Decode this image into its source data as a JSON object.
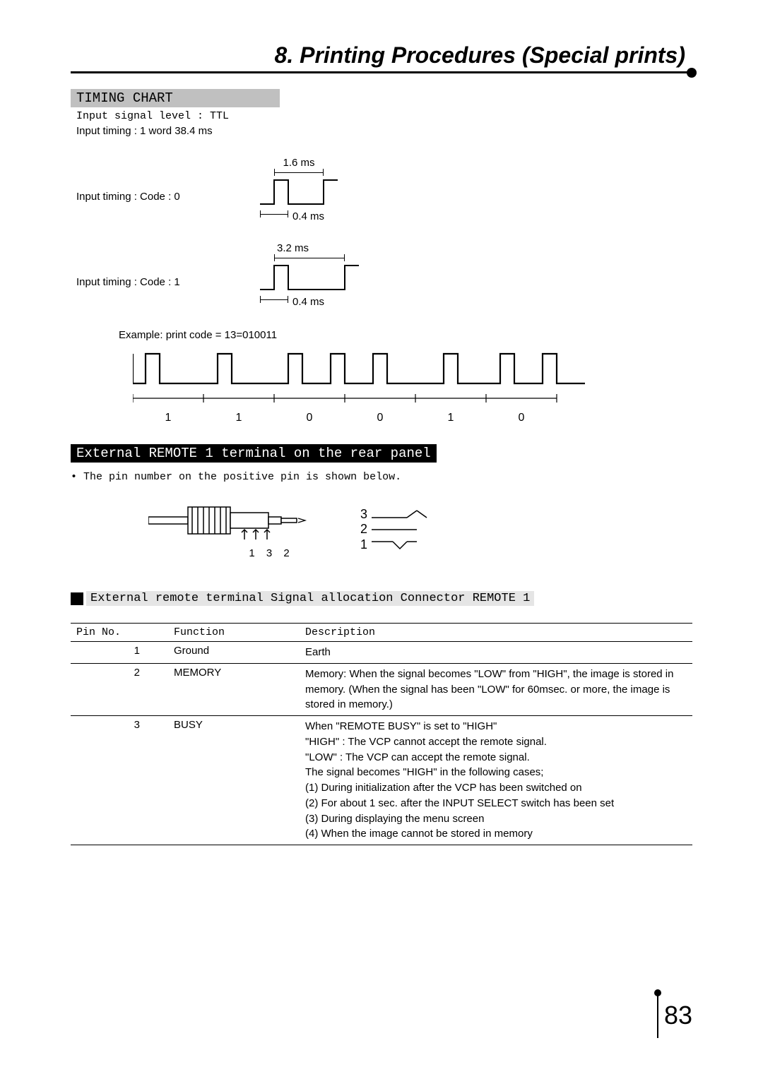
{
  "chapter_title": "8. Printing Procedures (Special prints)",
  "timing_chart": {
    "heading": "TIMING CHART",
    "input_signal_level": "Input signal level : TTL",
    "input_timing_word": "Input timing  : 1 word  38.4 ms",
    "code0": {
      "label": "Input timing : Code :  0",
      "high_width": "1.6 ms",
      "pulse_width": "0.4 ms"
    },
    "code1": {
      "label": "Input timing : Code :  1",
      "high_width": "3.2 ms",
      "pulse_width": "0.4 ms"
    },
    "example_label": "Example: print code = 13=010011",
    "example_bits": [
      "1",
      "1",
      "0",
      "0",
      "1",
      "0"
    ]
  },
  "remote_terminal": {
    "heading": "External REMOTE 1 terminal on the rear panel",
    "note": "• The pin number on the positive pin is shown below.",
    "plug_pin_labels": "1 3 2",
    "socket_pins": [
      "3",
      "2",
      "1"
    ]
  },
  "signal_alloc": {
    "heading": "External remote  terminal  Signal allocation Connector REMOTE 1",
    "columns": [
      "Pin No.",
      "Function",
      "Description"
    ],
    "rows": [
      {
        "pin": "1",
        "func": "Ground",
        "desc": "Earth"
      },
      {
        "pin": "2",
        "func": "MEMORY",
        "desc": "Memory: When the signal becomes \"LOW\" from \"HIGH\", the image is stored in memory.  (When the signal has been \"LOW\" for 60msec. or more, the image is stored in memory.)"
      },
      {
        "pin": "3",
        "func": "BUSY",
        "desc": "When \"REMOTE BUSY\" is set to \"HIGH\"\n\"HIGH\"  : The VCP cannot accept the remote signal.\n\"LOW\"  : The VCP can accept the remote signal.\nThe signal becomes \"HIGH\" in the following cases;\n    (1) During initialization after the VCP has been switched on\n    (2) For about 1 sec. after the INPUT SELECT switch has been set\n    (3) During displaying the menu screen\n    (4) When the image cannot be stored in memory"
      }
    ]
  },
  "page_number": "83"
}
